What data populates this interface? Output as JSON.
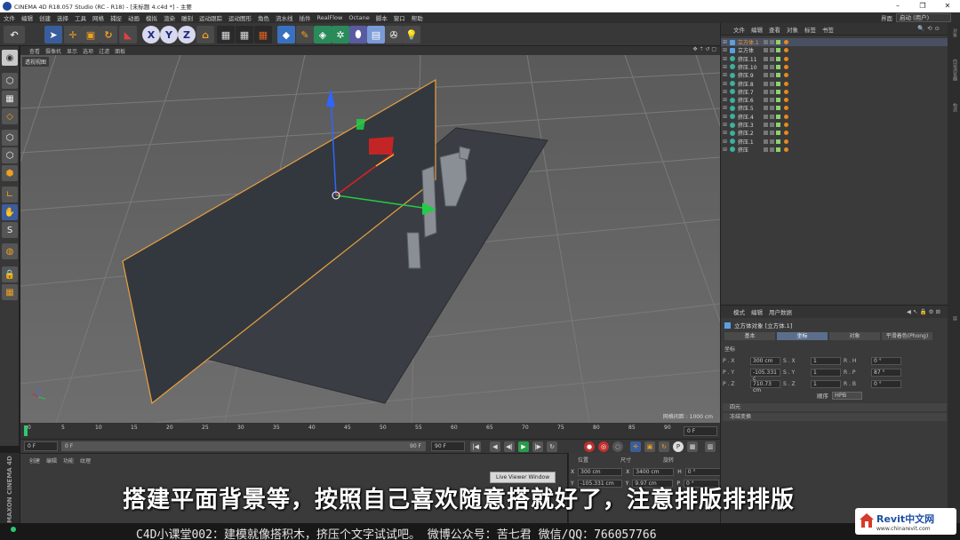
{
  "titlebar": {
    "title": "CINEMA 4D R18.057 Studio (RC - R18) - [未标题 4.c4d *] - 主要"
  },
  "menu": [
    "文件",
    "编辑",
    "创建",
    "选择",
    "工具",
    "网格",
    "捕捉",
    "动画",
    "模拟",
    "渲染",
    "雕刻",
    "运动跟踪",
    "运动图形",
    "角色",
    "流水线",
    "插件",
    "RealFlow",
    "Octane",
    "脚本",
    "窗口",
    "帮助"
  ],
  "layout": {
    "label": "界面",
    "value": "启动 (用户)"
  },
  "viewport": {
    "menu": [
      "查看",
      "摄像机",
      "显示",
      "选项",
      "过滤",
      "面板"
    ],
    "label": "透视视图",
    "grid_info": "网格间距 : 1000 cm"
  },
  "timeline": {
    "ticks": [
      "0",
      "5",
      "10",
      "15",
      "20",
      "25",
      "30",
      "35",
      "40",
      "45",
      "50",
      "55",
      "60",
      "65",
      "70",
      "75",
      "80",
      "85",
      "90"
    ],
    "end": "0 F"
  },
  "transport": {
    "start": "0 F",
    "current": "0 F",
    "range_end": "90 F",
    "end": "90 F"
  },
  "material_manager": {
    "menu": [
      "创建",
      "编辑",
      "功能",
      "纹理"
    ],
    "live_viewer": "Live Viewer Window"
  },
  "coordinates": {
    "headers": [
      "位置",
      "尺寸",
      "旋转"
    ],
    "rows": [
      {
        "axis": "X",
        "pos": "300 cm",
        "size_axis": "X",
        "size": "3400 cm",
        "rot_axis": "H",
        "rot": "0 °"
      },
      {
        "axis": "Y",
        "pos": "-105.331 cm",
        "size_axis": "Y",
        "size": "9.97 cm",
        "rot_axis": "P",
        "rot": "0 °"
      }
    ]
  },
  "objects": {
    "menu": [
      "文件",
      "编辑",
      "查看",
      "对象",
      "标签",
      "书签"
    ],
    "items": [
      {
        "name": "立方体.1",
        "type": "cube",
        "selected": true
      },
      {
        "name": "立方体",
        "type": "cube",
        "selected": false
      },
      {
        "name": "挤压.11",
        "type": "extrude",
        "selected": false
      },
      {
        "name": "挤压.10",
        "type": "extrude",
        "selected": false
      },
      {
        "name": "挤压.9",
        "type": "extrude",
        "selected": false
      },
      {
        "name": "挤压.8",
        "type": "extrude",
        "selected": false
      },
      {
        "name": "挤压.7",
        "type": "extrude",
        "selected": false
      },
      {
        "name": "挤压.6",
        "type": "extrude",
        "selected": false
      },
      {
        "name": "挤压.5",
        "type": "extrude",
        "selected": false
      },
      {
        "name": "挤压.4",
        "type": "extrude",
        "selected": false
      },
      {
        "name": "挤压.3",
        "type": "extrude",
        "selected": false
      },
      {
        "name": "挤压.2",
        "type": "extrude",
        "selected": false
      },
      {
        "name": "挤压.1",
        "type": "extrude",
        "selected": false
      },
      {
        "name": "挤压",
        "type": "extrude",
        "selected": false
      }
    ]
  },
  "attributes": {
    "menu": [
      "模式",
      "编辑",
      "用户数据"
    ],
    "title": "立方体对象 [立方体.1]",
    "tabs": [
      "基本",
      "坐标",
      "对象",
      "平滑着色(Phong)"
    ],
    "active_tab": 1,
    "section": "坐标",
    "rows": [
      {
        "p_label": "P . X",
        "p": "300 cm",
        "s_label": "S . X",
        "s": "1",
        "r_label": "R . H",
        "r": "0 °"
      },
      {
        "p_label": "P . Y",
        "p": "-105.331 c",
        "s_label": "S . Y",
        "s": "1",
        "r_label": "R . P",
        "r": "87 °"
      },
      {
        "p_label": "P . Z",
        "p": "710.73 cm",
        "s_label": "S . Z",
        "s": "1",
        "r_label": "R . B",
        "r": "0 °"
      }
    ],
    "order_label": "顺序",
    "order_value": "HPB",
    "folds": [
      "四元",
      "冻结变换"
    ]
  },
  "side_tabs": [
    "对象",
    "内容浏览器",
    "构造",
    "层"
  ],
  "overlay": {
    "subtitle": "搭建平面背景等，按照自己喜欢随意搭就好了，注意排版排排版",
    "caption": "C4D小课堂002：建模就像搭积木，挤压个文字试试吧。  微博公众号：苦七君  微信/QQ：766057766",
    "watermark_title": "Revit中文网",
    "watermark_url": "www.chinarevit.com",
    "maxon": "MAXON CINEMA 4D"
  }
}
